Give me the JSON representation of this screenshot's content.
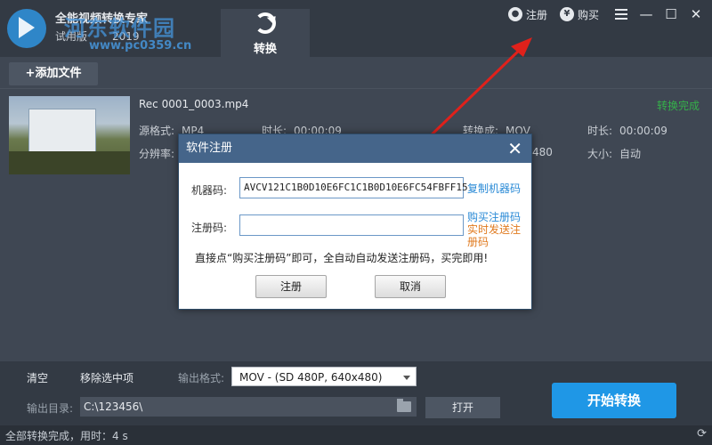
{
  "app": {
    "name": "全能视频转换专家",
    "edition": "试用版",
    "year": "2019",
    "watermark": "河东软件园",
    "watermark_url": "www.pc0359.cn"
  },
  "top_actions": {
    "register_label": "注册",
    "buy_label": "购买",
    "buy_symbol": "¥"
  },
  "tabs": {
    "convert_label": "转换"
  },
  "toolbar": {
    "add_file_label": "+添加文件"
  },
  "file": {
    "name": "Rec 0001_0003.mp4",
    "status": "转换完成",
    "source_format_label": "源格式:",
    "source_format": "MP4",
    "duration_label": "时长:",
    "duration": "00:00:09",
    "resolution_label": "分辨率:",
    "convert_to_label": "转换成:",
    "convert_to": "MOV",
    "out_duration_label": "时长:",
    "out_duration": "00:00:09",
    "out_resolution": "480",
    "size_label": "大小:",
    "size": "自动"
  },
  "dialog": {
    "title": "软件注册",
    "machine_code_label": "机器码:",
    "machine_code": "AVCV121C1B0D10E6FC1C1B0D10E6FC54FBFF15",
    "copy_link": "复制机器码",
    "reg_code_label": "注册码:",
    "reg_code": "",
    "buy_link": "购买注册码",
    "realtime_link": "实时发送注册码",
    "note": "直接点“购买注册码”即可，全自动自动发送注册码，买完即用!",
    "ok_label": "注册",
    "cancel_label": "取消"
  },
  "bottom": {
    "clear_label": "清空",
    "remove_label": "移除选中项",
    "output_format_label": "输出格式:",
    "output_format": "MOV - (SD 480P, 640x480)",
    "output_dir_label": "输出目录:",
    "output_dir": "C:\\123456\\",
    "open_label": "打开",
    "start_label": "开始转换"
  },
  "status": {
    "text": "全部转换完成，用时：4 s"
  },
  "colors": {
    "accent": "#1f97e6",
    "done_green": "#35b04a",
    "arrow_red": "#e0211b"
  }
}
